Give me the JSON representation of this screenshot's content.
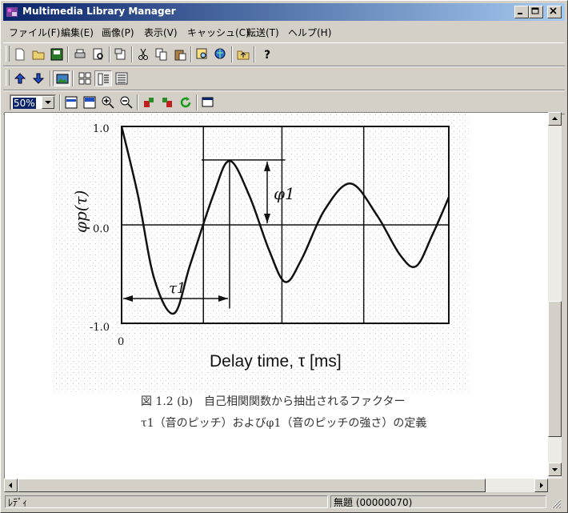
{
  "window": {
    "title": "Multimedia Library Manager",
    "caption_buttons": [
      "minimize-button",
      "maximize-button",
      "close-button"
    ]
  },
  "menubar": {
    "items": [
      "ファイル(F)",
      "編集(E)",
      "画像(P)",
      "表示(V)",
      "キャッシュ(C)",
      "転送(T)",
      "ヘルプ(H)"
    ]
  },
  "toolbar": {
    "zoom_value": "50%"
  },
  "figure": {
    "y_axis_label": "φp(τ)",
    "x_axis_label": "Delay time, τ [ms]",
    "y_ticks": [
      "1.0",
      "0.0",
      "-1.0"
    ],
    "x_ticks": [
      "0"
    ],
    "annotation_tau": "τ1",
    "annotation_phi": "φ1",
    "caption_line1": "図 1.2 (b)　自己相関関数から抽出されるファクター",
    "caption_line2": "τ1（音のピッチ）およびφ1（音のピッチの強さ）の定義"
  },
  "chart_data": {
    "type": "line",
    "title": "",
    "xlabel": "Delay time, τ [ms]",
    "ylabel": "φp(τ)",
    "ylim": [
      -1.0,
      1.0
    ],
    "grid": true,
    "series": [
      {
        "x": [
          0,
          0.05,
          0.1,
          0.16,
          0.21,
          0.28,
          0.33,
          0.39,
          0.45,
          0.5,
          0.55,
          0.62,
          0.7,
          0.78,
          0.85,
          0.9,
          0.95,
          1.0
        ],
        "values": [
          1.0,
          0.3,
          -0.55,
          -0.9,
          -0.4,
          0.3,
          0.65,
          0.3,
          -0.25,
          -0.58,
          -0.35,
          0.15,
          0.42,
          0.1,
          -0.3,
          -0.42,
          -0.1,
          0.28
        ]
      }
    ],
    "annotations": [
      "τ1",
      "φ1"
    ]
  },
  "statusbar": {
    "ready": "ﾚﾃﾞｨ",
    "document": "無題 (00000070)"
  }
}
